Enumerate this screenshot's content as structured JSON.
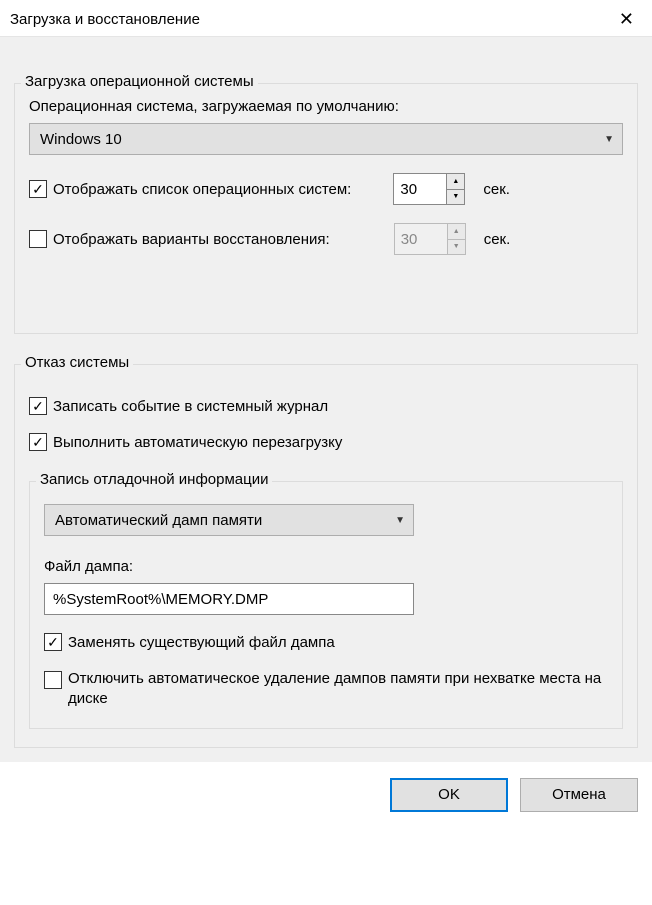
{
  "title": "Загрузка и восстановление",
  "startup": {
    "legend": "Загрузка операционной системы",
    "default_os_label": "Операционная система, загружаемая по умолчанию:",
    "default_os_value": "Windows 10",
    "show_os_list_label": "Отображать список операционных систем:",
    "show_os_list_checked": true,
    "show_os_list_seconds": "30",
    "show_recovery_label": "Отображать варианты восстановления:",
    "show_recovery_checked": false,
    "show_recovery_seconds": "30",
    "seconds_unit": "сек."
  },
  "failure": {
    "legend": "Отказ системы",
    "write_event_label": "Записать событие в системный журнал",
    "write_event_checked": true,
    "auto_restart_label": "Выполнить автоматическую перезагрузку",
    "auto_restart_checked": true,
    "debug_info": {
      "legend": "Запись отладочной информации",
      "dump_type": "Автоматический дамп памяти",
      "dump_file_label": "Файл дампа:",
      "dump_file_value": "%SystemRoot%\\MEMORY.DMP",
      "overwrite_label": "Заменять существующий файл дампа",
      "overwrite_checked": true,
      "disable_auto_delete_label": "Отключить автоматическое удаление дампов памяти при нехватке места на диске",
      "disable_auto_delete_checked": false
    }
  },
  "buttons": {
    "ok": "OK",
    "cancel": "Отмена"
  }
}
